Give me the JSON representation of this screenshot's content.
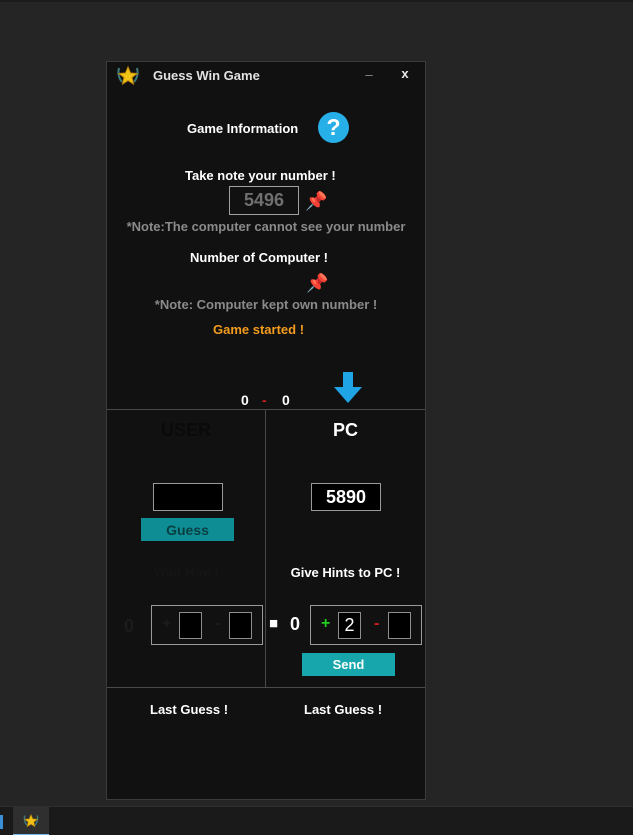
{
  "window": {
    "title": "Guess Win Game",
    "minimize": "_",
    "close": "x"
  },
  "info": {
    "game_information": "Game Information",
    "help_glyph": "?",
    "take_note": "Take note your number !",
    "your_number": "5496",
    "note_user": "*Note:The computer cannot see your number",
    "number_of_computer": "Number of Computer !",
    "note_pc": "*Note: Computer kept own number !",
    "status": "Game started !"
  },
  "score": {
    "user": "0",
    "separator": "-",
    "pc": "0"
  },
  "user_panel": {
    "title": "USER",
    "guess_value": "",
    "guess_button": "Guess",
    "hint_title": "Your Hint !",
    "count": "0",
    "plus": "+",
    "minus": "-"
  },
  "pc_panel": {
    "title": "PC",
    "guess_value": "5890",
    "hint_title": "Give Hints to PC !",
    "checkbox_glyph": "■",
    "count": "0",
    "plus": "+",
    "plus_value": "2",
    "minus": "-",
    "minus_value": "",
    "send_button": "Send"
  },
  "footer": {
    "user_last_guess": "Last Guess !",
    "pc_last_guess": "Last Guess !"
  },
  "icons": [
    "trophy-icon",
    "help-icon",
    "pin-icon",
    "down-arrow-icon"
  ],
  "colors": {
    "background": "#111111",
    "teal": "#16a6ab",
    "status_orange": "#f39c1d",
    "help_blue": "#27b0e8",
    "plus_green": "#22cc22",
    "minus_red": "#d62020"
  }
}
